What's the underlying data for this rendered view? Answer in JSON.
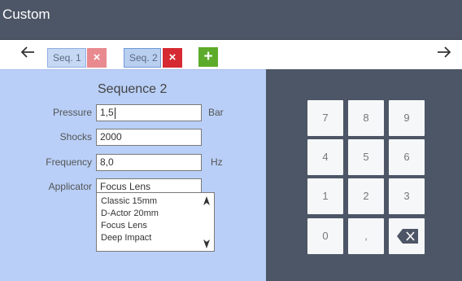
{
  "window": {
    "title": "Custom"
  },
  "nav": {
    "prev_icon": "arrow-left-icon",
    "next_icon": "arrow-right-icon"
  },
  "tabs": [
    {
      "label": "Seq. 1",
      "close": "×"
    },
    {
      "label": "Seq. 2",
      "close": "×"
    }
  ],
  "add_label": "+",
  "form": {
    "heading": "Sequence 2",
    "pressure": {
      "label": "Pressure",
      "value": "1,5",
      "unit": "Bar"
    },
    "shocks": {
      "label": "Shocks",
      "value": "2000"
    },
    "frequency": {
      "label": "Frequency",
      "value": "8,0",
      "unit": "Hz"
    },
    "applicator": {
      "label": "Applicator",
      "value": "Focus Lens",
      "options": [
        "Classic 15mm",
        "D-Actor 20mm",
        "Focus Lens",
        "Deep Impact"
      ]
    }
  },
  "keypad": {
    "k7": "7",
    "k8": "8",
    "k9": "9",
    "k4": "4",
    "k5": "5",
    "k6": "6",
    "k1": "1",
    "k2": "2",
    "k3": "3",
    "k0": "0",
    "comma": ",",
    "backspace_icon": "backspace-icon"
  },
  "colors": {
    "titlebar": "#4d5666",
    "form_panel": "#b9cff7",
    "keypad_panel": "#4d5666",
    "close_active": "#d62a33",
    "close_inactive": "#e88a8f",
    "add": "#5dab2b"
  }
}
